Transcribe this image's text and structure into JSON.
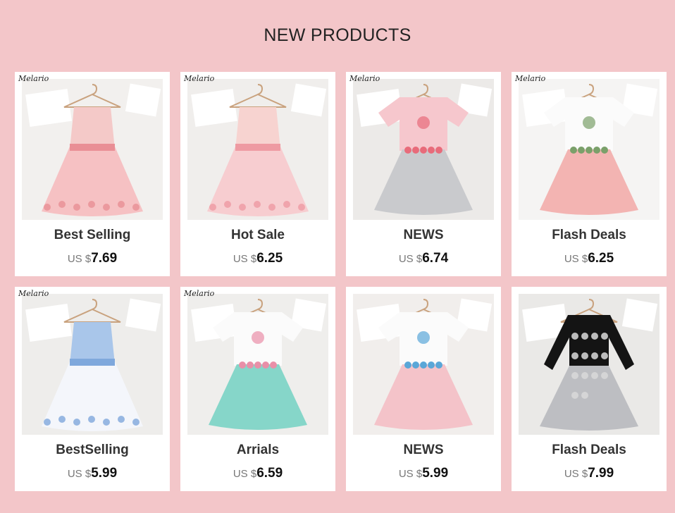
{
  "section": {
    "title": "NEW PRODUCTS"
  },
  "colors": {
    "background": "#f3c6c9",
    "card": "#ffffff"
  },
  "products": [
    {
      "brand": "Melario",
      "name": "Best Selling",
      "currency": "US $",
      "price": "7.69",
      "image": {
        "bg": "#f2f0ee",
        "top": "#f4c9c8",
        "skirt": "#f6c1c3",
        "accent": "#e98e95",
        "style": "dress"
      }
    },
    {
      "brand": "Melario",
      "name": "Hot Sale",
      "currency": "US $",
      "price": "6.25",
      "image": {
        "bg": "#f0eeec",
        "top": "#f7d3d0",
        "skirt": "#f7cdd0",
        "accent": "#ee9aa2",
        "style": "dress"
      }
    },
    {
      "brand": "Melario",
      "name": "NEWS",
      "currency": "US $",
      "price": "6.74",
      "image": {
        "bg": "#eceae8",
        "top": "#f6c7cd",
        "skirt": "#c9cacd",
        "accent": "#e86b7a",
        "style": "set"
      }
    },
    {
      "brand": "Melario",
      "name": "Flash Deals",
      "currency": "US $",
      "price": "6.25",
      "image": {
        "bg": "#f5f4f3",
        "top": "#fbfbfb",
        "skirt": "#f3b4b2",
        "accent": "#7aa06a",
        "style": "set"
      }
    },
    {
      "brand": "Melario",
      "name": "BestSelling",
      "currency": "US $",
      "price": "5.99",
      "image": {
        "bg": "#eeedeb",
        "top": "#a9c6ea",
        "skirt": "#f4f6fb",
        "accent": "#7fa8dc",
        "style": "dress"
      }
    },
    {
      "brand": "Melario",
      "name": "Arrials",
      "currency": "US $",
      "price": "6.59",
      "image": {
        "bg": "#efeeec",
        "top": "#fbfbfb",
        "skirt": "#86d6c9",
        "accent": "#e98fa8",
        "style": "set"
      }
    },
    {
      "brand": "",
      "name": "NEWS",
      "currency": "US $",
      "price": "5.99",
      "image": {
        "bg": "#f1eeec",
        "top": "#fbfbfb",
        "skirt": "#f4c3c9",
        "accent": "#5aa7d8",
        "style": "set"
      }
    },
    {
      "brand": "",
      "name": "Flash Deals",
      "currency": "US $",
      "price": "7.99",
      "image": {
        "bg": "#eae9e7",
        "top": "#141414",
        "skirt": "#bdbec2",
        "accent": "#d9d9d9",
        "style": "longsleeve"
      }
    }
  ]
}
